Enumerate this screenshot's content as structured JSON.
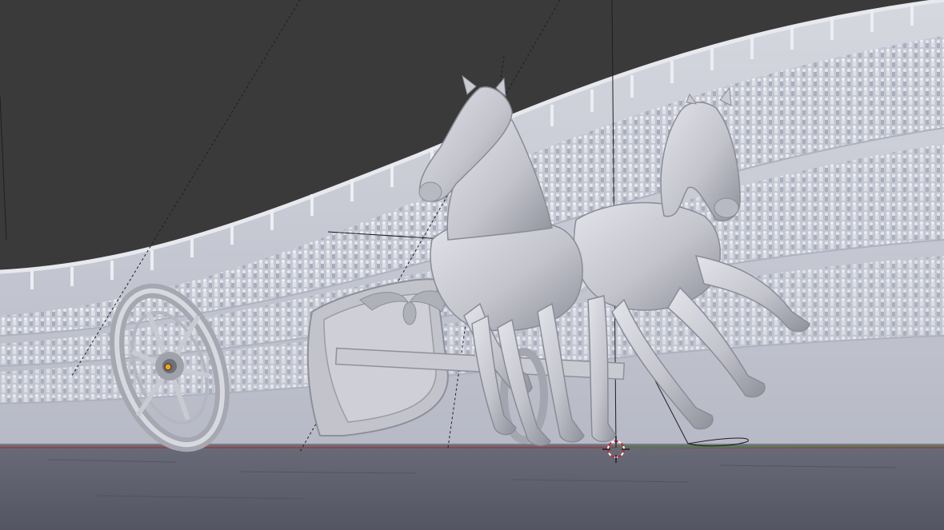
{
  "viewport": {
    "mode": "solid-shading",
    "colors": {
      "sky": "#3a3a3a",
      "stand": "#c9ccd6",
      "stand_shade": "#a9adbb",
      "crowd": "#dfe1e8",
      "floor": "#5c5d6c",
      "model": "#c7c8cf",
      "model_shade": "#9d9fa8",
      "axis_x": "#b03030",
      "axis_y": "#3f8f3f",
      "cursor": "#c82828",
      "origin": "#f0a020"
    },
    "icons": {
      "cursor": "3d-cursor-icon",
      "origin": "object-origin-icon"
    }
  }
}
